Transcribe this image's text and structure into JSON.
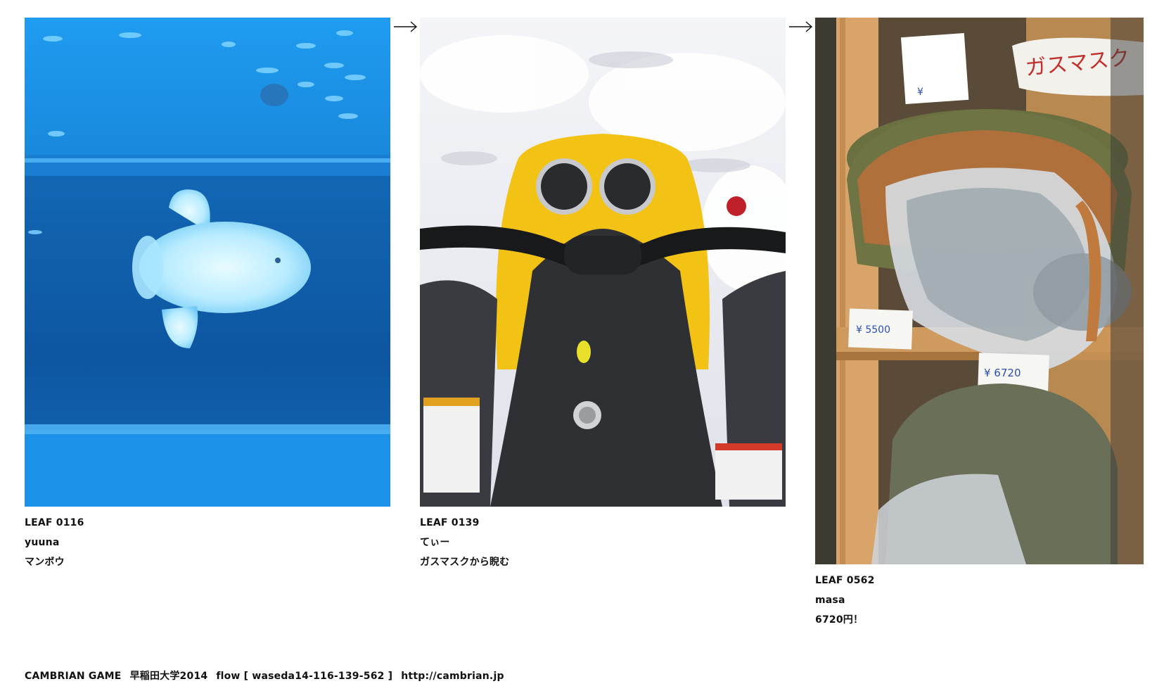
{
  "leaves": [
    {
      "id": "LEAF 0116",
      "user": "yuuna",
      "comment": "マンボウ",
      "photo_icon": "sunfish-aquarium-photo"
    },
    {
      "id": "LEAF 0139",
      "user": "てぃー",
      "comment": "ガスマスクから睨む",
      "photo_icon": "snowmobile-handlebar-photo"
    },
    {
      "id": "LEAF 0562",
      "user": "masa",
      "comment": "6720円！",
      "photo_icon": "helmet-gasmask-shelf-photo",
      "photo_texts": {
        "sign": "ガスマスク",
        "tag_top": "¥",
        "tag_left": "¥ 5500",
        "tag_right": "¥ 6720"
      }
    }
  ],
  "arrows": [
    "→",
    "→"
  ],
  "footer": {
    "game": "CAMBRIAN GAME",
    "school": "早稲田大学2014",
    "flow": "flow [ waseda14-116-139-562 ]",
    "url": "http://cambrian.jp"
  },
  "colors": {
    "background": "#ffffff",
    "text": "#111111",
    "aquarium_blue": "#1a8fe0",
    "snowmobile_yellow": "#f2c314"
  }
}
